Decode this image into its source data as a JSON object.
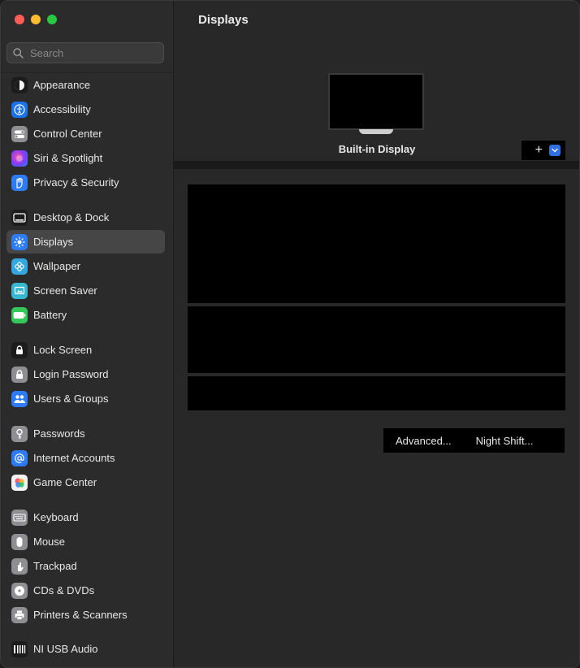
{
  "sidebar": {
    "search_placeholder": "Search",
    "items": [
      {
        "label": "Appearance",
        "icon": "appearance-icon",
        "color": "#1c1c1c"
      },
      {
        "label": "Accessibility",
        "icon": "accessibility-icon",
        "color": "#1a73e8"
      },
      {
        "label": "Control Center",
        "icon": "control-center-icon",
        "color": "#8e8e93"
      },
      {
        "label": "Siri & Spotlight",
        "icon": "siri-icon",
        "color": "#8a2be2"
      },
      {
        "label": "Privacy & Security",
        "icon": "privacy-hand-icon",
        "color": "#2d7cf6"
      },
      {
        "label": "Desktop & Dock",
        "icon": "desktop-dock-icon",
        "color": "#1c1c1c"
      },
      {
        "label": "Displays",
        "icon": "displays-icon",
        "color": "#2d7cf6",
        "selected": true
      },
      {
        "label": "Wallpaper",
        "icon": "wallpaper-icon",
        "color": "#35a7e0"
      },
      {
        "label": "Screen Saver",
        "icon": "screen-saver-icon",
        "color": "#35b8d0"
      },
      {
        "label": "Battery",
        "icon": "battery-icon",
        "color": "#34c759"
      },
      {
        "label": "Lock Screen",
        "icon": "lock-icon",
        "color": "#1c1c1c"
      },
      {
        "label": "Login Password",
        "icon": "login-password-icon",
        "color": "#8e8e93"
      },
      {
        "label": "Users & Groups",
        "icon": "users-icon",
        "color": "#2d7cf6"
      },
      {
        "label": "Passwords",
        "icon": "key-icon",
        "color": "#8e8e93"
      },
      {
        "label": "Internet Accounts",
        "icon": "at-icon",
        "color": "#2d7cf6"
      },
      {
        "label": "Game Center",
        "icon": "game-center-icon",
        "color": "#f2f2f2"
      },
      {
        "label": "Keyboard",
        "icon": "keyboard-icon",
        "color": "#8e8e93"
      },
      {
        "label": "Mouse",
        "icon": "mouse-icon",
        "color": "#8e8e93"
      },
      {
        "label": "Trackpad",
        "icon": "trackpad-icon",
        "color": "#8e8e93"
      },
      {
        "label": "CDs & DVDs",
        "icon": "disc-icon",
        "color": "#8e8e93"
      },
      {
        "label": "Printers & Scanners",
        "icon": "printer-icon",
        "color": "#8e8e93"
      },
      {
        "label": "NI USB Audio",
        "icon": "ni-audio-icon",
        "color": "#1c1c1c"
      }
    ]
  },
  "main": {
    "title": "Displays",
    "display_name": "Built-in Display",
    "add_symbol": "+",
    "advanced_label": "Advanced...",
    "night_shift_label": "Night Shift..."
  }
}
